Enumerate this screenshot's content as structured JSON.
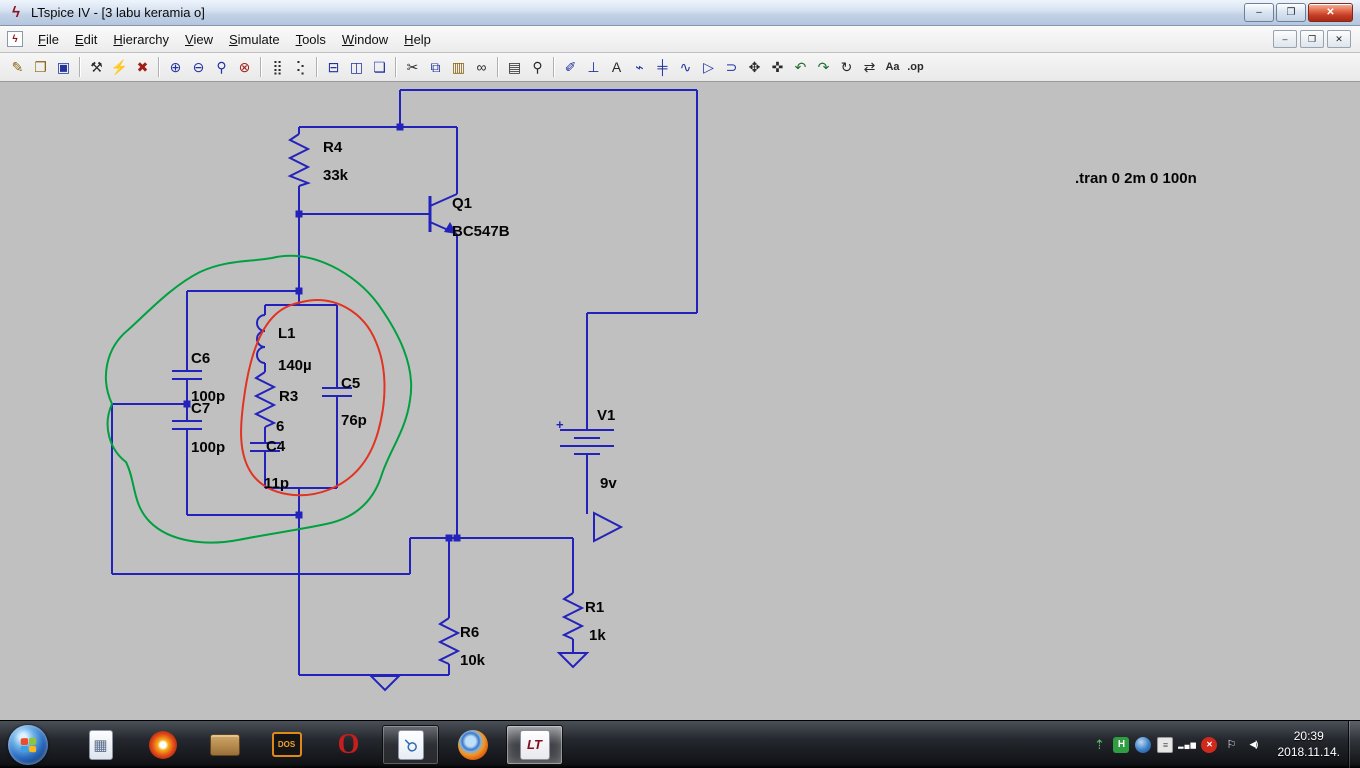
{
  "window": {
    "title": "LTspice IV - [3 labu keramia o]",
    "controls": {
      "minimize": "–",
      "maximize": "❐",
      "close": "✕"
    },
    "mdi": {
      "minimize": "–",
      "restore": "❐",
      "close": "✕"
    }
  },
  "menu": {
    "items": [
      {
        "label": "File"
      },
      {
        "label": "Edit"
      },
      {
        "label": "Hierarchy"
      },
      {
        "label": "View"
      },
      {
        "label": "Simulate"
      },
      {
        "label": "Tools"
      },
      {
        "label": "Window"
      },
      {
        "label": "Help"
      }
    ]
  },
  "toolbar": {
    "items": [
      {
        "name": "new-schematic",
        "glyph": "✎"
      },
      {
        "name": "open-file",
        "glyph": "❐"
      },
      {
        "name": "save",
        "glyph": "▣"
      },
      {
        "name": "control-panel",
        "glyph": "⚒"
      },
      {
        "name": "run-simulation",
        "glyph": "⚡"
      },
      {
        "name": "halt-simulation",
        "glyph": "✖"
      },
      {
        "name": "zoom-in",
        "glyph": "⊕"
      },
      {
        "name": "zoom-out",
        "glyph": "⊖"
      },
      {
        "name": "zoom-full-extents",
        "glyph": "⚲"
      },
      {
        "name": "zoom-reset",
        "glyph": "⊗"
      },
      {
        "name": "show-grid",
        "glyph": "⣿"
      },
      {
        "name": "snap-to-grid",
        "glyph": "⢕"
      },
      {
        "name": "tile-horizontal",
        "glyph": "⊟"
      },
      {
        "name": "tile-vertical",
        "glyph": "◫"
      },
      {
        "name": "cascade-windows",
        "glyph": "❏"
      },
      {
        "name": "cut",
        "glyph": "✂"
      },
      {
        "name": "copy",
        "glyph": "⧉"
      },
      {
        "name": "paste",
        "glyph": "▥"
      },
      {
        "name": "find",
        "glyph": "∞"
      },
      {
        "name": "print",
        "glyph": "▤"
      },
      {
        "name": "print-preview",
        "glyph": "⚲"
      },
      {
        "name": "draw-wire",
        "glyph": "✐"
      },
      {
        "name": "place-ground",
        "glyph": "⊥"
      },
      {
        "name": "net-label",
        "glyph": "A"
      },
      {
        "name": "place-resistor",
        "glyph": "⌁"
      },
      {
        "name": "place-capacitor",
        "glyph": "╪"
      },
      {
        "name": "place-inductor",
        "glyph": "∿"
      },
      {
        "name": "place-diode",
        "glyph": "▷"
      },
      {
        "name": "place-component",
        "glyph": "⊃"
      },
      {
        "name": "move",
        "glyph": "✥"
      },
      {
        "name": "drag",
        "glyph": "✜"
      },
      {
        "name": "undo",
        "glyph": "↶"
      },
      {
        "name": "redo",
        "glyph": "↷"
      },
      {
        "name": "rotate",
        "glyph": "↻"
      },
      {
        "name": "mirror",
        "glyph": "⇄"
      },
      {
        "name": "add-text",
        "glyph": "Aa"
      },
      {
        "name": "spice-directive",
        "glyph": ".op"
      }
    ]
  },
  "schematic": {
    "background": "#c0c0c0",
    "wire_color": "#2323bb",
    "annotation_green": "#00a040",
    "annotation_red": "#e23222",
    "directive": ".tran 0 2m 0 100n",
    "battery_plus": "+",
    "components": [
      {
        "ref": "R4",
        "value": "33k"
      },
      {
        "ref": "Q1",
        "value": "BC547B"
      },
      {
        "ref": "C6",
        "value": "100p"
      },
      {
        "ref": "C7",
        "value": "100p"
      },
      {
        "ref": "L1",
        "value": "140µ"
      },
      {
        "ref": "R3",
        "value": "6"
      },
      {
        "ref": "C4",
        "value": "11p"
      },
      {
        "ref": "C5",
        "value": "76p"
      },
      {
        "ref": "V1",
        "value": "9v"
      },
      {
        "ref": "R6",
        "value": "10k"
      },
      {
        "ref": "R1",
        "value": "1k"
      }
    ]
  },
  "taskbar": {
    "apps": [
      {
        "name": "calculator",
        "glyph": "▦"
      },
      {
        "name": "image-viewer"
      },
      {
        "name": "file-manager"
      },
      {
        "name": "dosbox",
        "glyph": "DOS"
      },
      {
        "name": "opera",
        "glyph": "O"
      },
      {
        "name": "search-tool",
        "glyph": "⚲",
        "state": "open"
      },
      {
        "name": "firefox"
      },
      {
        "name": "ltspice",
        "glyph": "LT",
        "state": "active"
      }
    ],
    "tray": [
      {
        "name": "usb-device",
        "glyph": "⇡"
      },
      {
        "name": "disk-monitor",
        "glyph": "H"
      },
      {
        "name": "blue-app",
        "glyph": ""
      },
      {
        "name": "notes-app",
        "glyph": "≡"
      },
      {
        "name": "network-signal",
        "glyph": "▂▄▆"
      },
      {
        "name": "error-status",
        "glyph": "✕"
      },
      {
        "name": "action-center",
        "glyph": "⚐"
      },
      {
        "name": "volume",
        "glyph": "◀)"
      }
    ],
    "clock": {
      "time": "20:39",
      "date": "2018.11.14."
    }
  }
}
